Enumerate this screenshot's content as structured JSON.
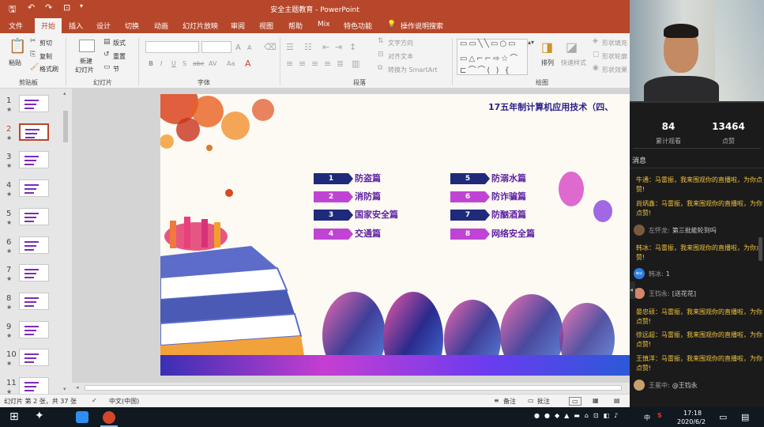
{
  "title_bar": {
    "doc_title": "安全主题教育 - PowerPoint"
  },
  "tabs": [
    "文件",
    "开始",
    "插入",
    "设计",
    "切换",
    "动画",
    "幻灯片放映",
    "审阅",
    "视图",
    "帮助",
    "Mix",
    "特色功能"
  ],
  "active_tab": "开始",
  "tell_me": "操作说明搜索",
  "ribbon": {
    "clipboard": {
      "paste": "粘贴",
      "cut": "剪切",
      "copy": "复制",
      "format_painter": "格式刷",
      "label": "剪贴板"
    },
    "slides": {
      "new_slide_1": "新建",
      "new_slide_2": "幻灯片",
      "layout": "版式",
      "reset": "重置",
      "section": "节",
      "label": "幻灯片"
    },
    "font": {
      "bold": "B",
      "italic": "I",
      "underline": "U",
      "strike": "S",
      "shadow": "abc",
      "spacing": "AV",
      "case": "Aa",
      "grow": "A",
      "shrink": "A",
      "label": "字体"
    },
    "paragraph": {
      "text_direction": "文字方向",
      "align_text": "对齐文本",
      "smartart": "转换为 SmartArt",
      "label": "段落"
    },
    "drawing": {
      "arrange": "排列",
      "quick_styles": "快速样式",
      "shape_fill": "形状填充",
      "shape_outline": "形状轮廓",
      "shape_effects": "形状效果",
      "label": "绘图"
    }
  },
  "thumbnails": [
    "1",
    "2",
    "3",
    "4",
    "5",
    "6",
    "7",
    "8",
    "9",
    "10",
    "11"
  ],
  "thumbnail_star": "★",
  "selected_slide": 2,
  "slide": {
    "header": "17五年制计算机应用技术（四、",
    "items": [
      {
        "num": "1",
        "label": "防盗篇",
        "color": "navy"
      },
      {
        "num": "2",
        "label": "消防篇",
        "color": "purple"
      },
      {
        "num": "3",
        "label": "国家安全篇",
        "color": "navy"
      },
      {
        "num": "4",
        "label": "交通篇",
        "color": "purple"
      },
      {
        "num": "5",
        "label": "防溺水篇",
        "color": "navy"
      },
      {
        "num": "6",
        "label": "防诈骗篇",
        "color": "purple"
      },
      {
        "num": "7",
        "label": "防酗酒篇",
        "color": "navy"
      },
      {
        "num": "8",
        "label": "网络安全篇",
        "color": "purple"
      }
    ]
  },
  "status_bar": {
    "slide_info": "幻灯片 第 2 张，共 37 张",
    "language": "中文(中国)",
    "notes": "备注",
    "comments": "批注"
  },
  "live": {
    "views_count": "84",
    "views_label": "累计观看",
    "likes_count": "13464",
    "likes_label": "点赞",
    "messages_title": "消息",
    "messages": [
      {
        "name": "牛通：",
        "text": "马雷振，我来围观你的直播啦，为你点赞!"
      },
      {
        "name": "尚炳鑫：",
        "text": "马雷振，我来围观你的直播啦，为你点赞!"
      },
      {
        "name": "左怀龙:",
        "text": "第三批能轮到吗",
        "avatar": true
      },
      {
        "name": "韩冰：",
        "text": "马雷振，我来围观你的直播啦，为你点赞!"
      },
      {
        "name": "韩冰:",
        "text": "1",
        "avatar": true,
        "avatar_text": "韩冰"
      },
      {
        "name": "王钧永:",
        "text": "[送花花]",
        "avatar": true
      },
      {
        "name": "晏忠硕：",
        "text": "马雷振，我来围观你的直播啦，为你点赞!"
      },
      {
        "name": "徐远超：",
        "text": "马雷振，我来围观你的直播啦，为你点赞!"
      },
      {
        "name": "王慎洋：",
        "text": "马雷振，我来围观你的直播啦，为你点赞!"
      },
      {
        "name": "王冕中:",
        "text": "@王钧永",
        "avatar": true
      }
    ]
  },
  "taskbar": {
    "ime": "中",
    "time": "17:18",
    "date": "2020/6/2"
  },
  "colors": {
    "ppt_red": "#b7472a",
    "navy": "#1f2a7a",
    "purple": "#c044d4",
    "title_purple": "#5a1fa0",
    "name_yellow": "#f0c23b"
  }
}
